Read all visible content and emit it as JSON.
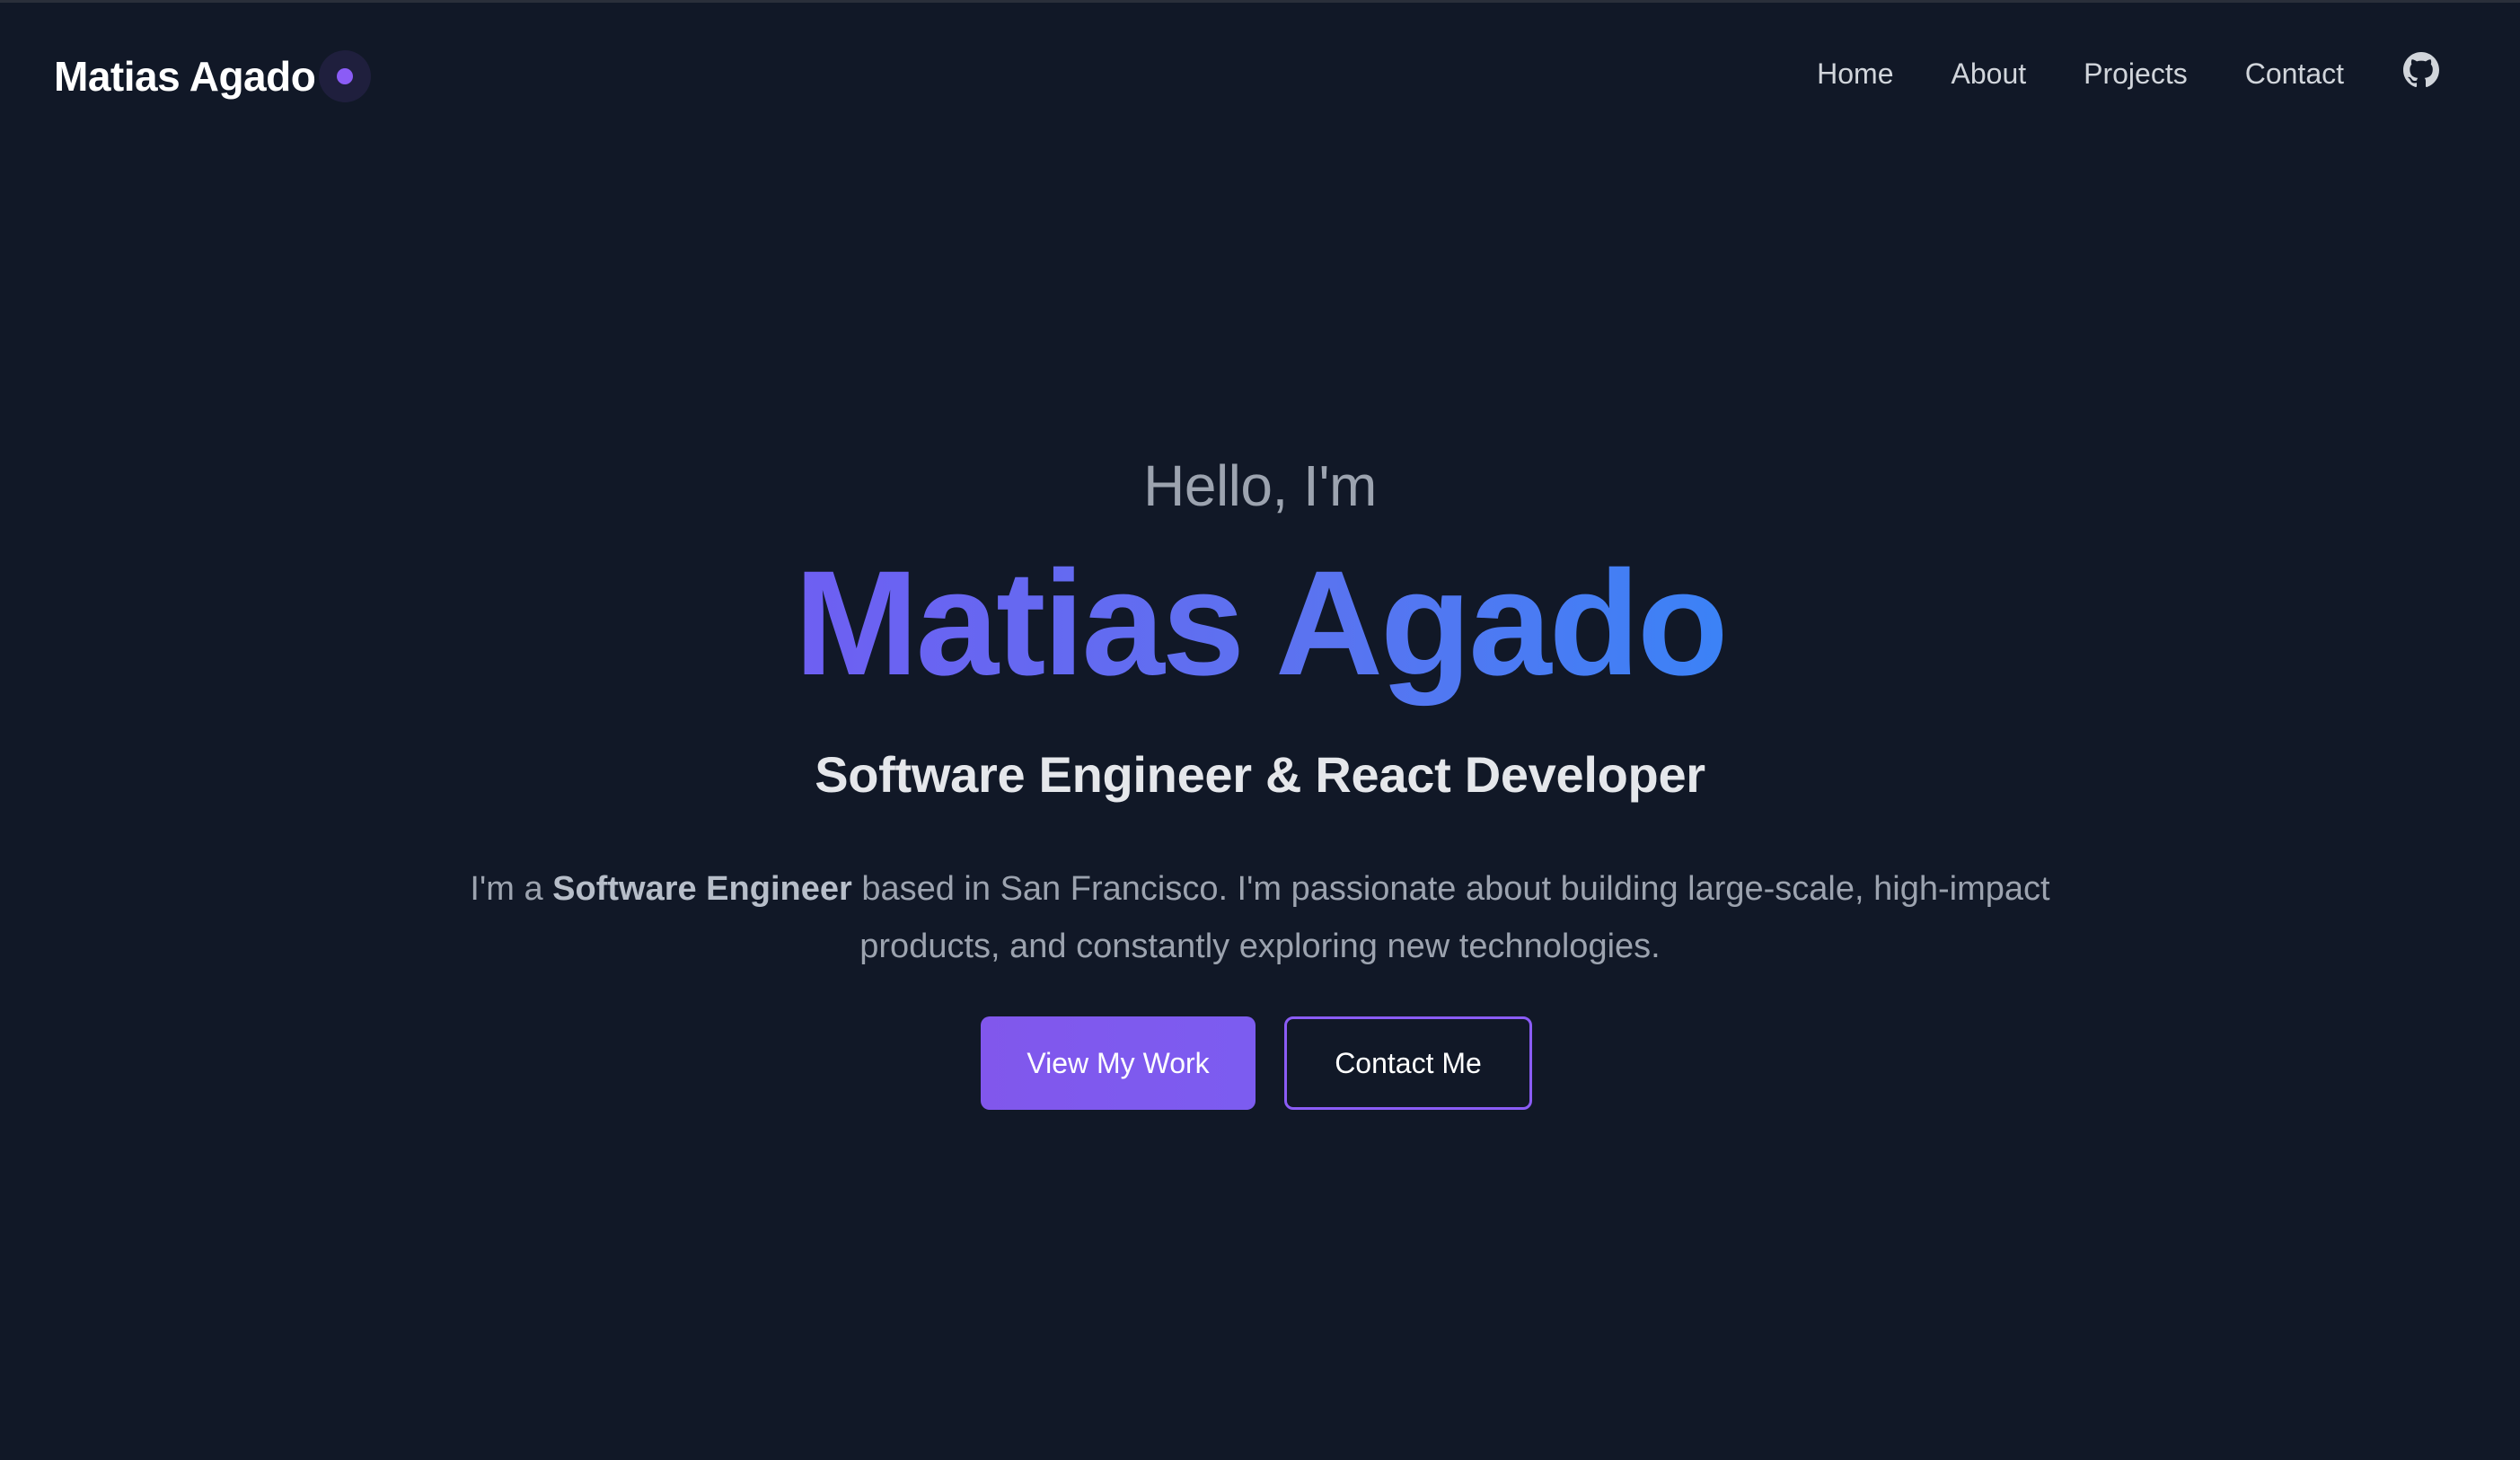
{
  "header": {
    "brand_name": "Matias Agado",
    "nav": [
      "Home",
      "About",
      "Projects",
      "Contact"
    ],
    "github_icon": "github-icon"
  },
  "hero": {
    "greeting": "Hello, I'm",
    "name": "Matias Agado",
    "role": "Software Engineer & React Developer",
    "bio_prefix": "I'm a ",
    "bio_bold": "Software Engineer",
    "bio_suffix": " based in San Francisco. I'm passionate about building large-scale, high-impact products, and constantly exploring new technologies.",
    "primary_button": "View My Work",
    "secondary_button": "Contact Me"
  },
  "colors": {
    "background": "#111827",
    "accent": "#8b5cf6",
    "gradient_start": "#6e5ff2",
    "gradient_end": "#3b82f6"
  }
}
